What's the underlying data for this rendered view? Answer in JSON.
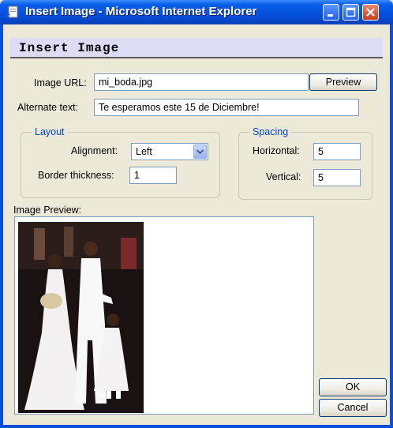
{
  "window": {
    "title": "Insert Image - Microsoft Internet Explorer"
  },
  "dialog": {
    "heading": "Insert Image"
  },
  "form": {
    "image_url_label": "Image URL:",
    "image_url_value": "mi_boda.jpg",
    "preview_button": "Preview",
    "alt_text_label": "Alternate text:",
    "alt_text_value": "Te esperamos este 15 de Diciembre!"
  },
  "layout": {
    "legend": "Layout",
    "alignment_label": "Alignment:",
    "alignment_value": "Left",
    "border_label": "Border thickness:",
    "border_value": "1"
  },
  "spacing": {
    "legend": "Spacing",
    "horizontal_label": "Horizontal:",
    "horizontal_value": "5",
    "vertical_label": "Vertical:",
    "vertical_value": "5"
  },
  "preview": {
    "label": "Image Preview:"
  },
  "actions": {
    "ok": "OK",
    "cancel": "Cancel"
  },
  "icons": {
    "title": "ie-page-icon",
    "minimize": "minimize-icon",
    "maximize": "maximize-icon",
    "close": "close-icon",
    "dropdown": "chevron-down-icon"
  },
  "colors": {
    "titlebar": "#0553e0",
    "face": "#ece9d8",
    "header_band": "#dcdcf5",
    "legend_text": "#0046d5"
  }
}
